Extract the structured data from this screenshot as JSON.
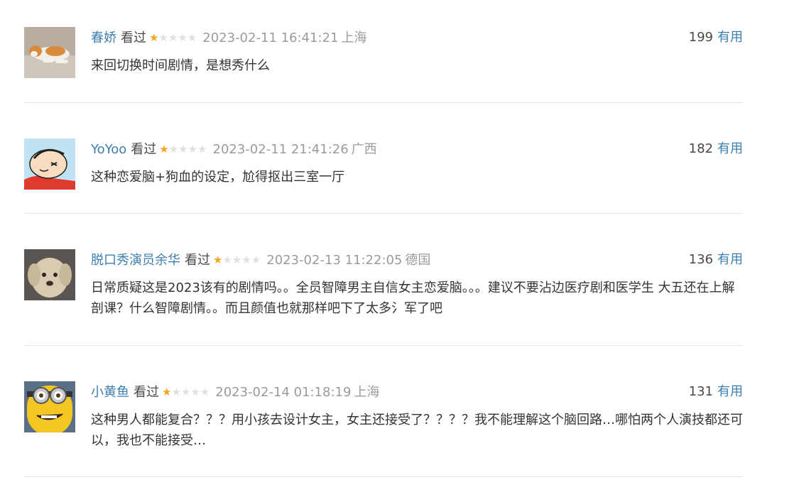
{
  "comments": [
    {
      "user": "春娇",
      "status": "看过",
      "rating": 1,
      "rating_max": 5,
      "time": "2023-02-11 16:41:21",
      "location": "上海",
      "votes": "199",
      "useful_label": "有用",
      "text": "来回切换时间剧情，是想秀什么",
      "avatar": "cat-photo"
    },
    {
      "user": "YoYoo",
      "status": "看过",
      "rating": 1,
      "rating_max": 5,
      "time": "2023-02-11 21:41:26",
      "location": "广西",
      "votes": "182",
      "useful_label": "有用",
      "text": "这种恋爱脑+狗血的设定，尬得抠出三室一厅",
      "avatar": "cartoon-boy"
    },
    {
      "user": "脱口秀演员余华",
      "status": "看过",
      "rating": 1,
      "rating_max": 5,
      "time": "2023-02-13 11:22:05",
      "location": "德国",
      "votes": "136",
      "useful_label": "有用",
      "text": "日常质疑这是2023该有的剧情吗。。全员智障男主自信女主恋爱脑。。。建议不要沾边医疗剧和医学生 大五还在上解剖课？什么智障剧情。。而且颜值也就那样吧下了太多氵军了吧",
      "avatar": "puppy-photo"
    },
    {
      "user": "小黄鱼",
      "status": "看过",
      "rating": 1,
      "rating_max": 5,
      "time": "2023-02-14 01:18:19",
      "location": "上海",
      "votes": "131",
      "useful_label": "有用",
      "text": "这种男人都能复合？？？用小孩去设计女主，女主还接受了？？？？我不能理解这个脑回路…哪怕两个人演技都还可以，我也不能接受…",
      "avatar": "minion-cartoon"
    }
  ]
}
